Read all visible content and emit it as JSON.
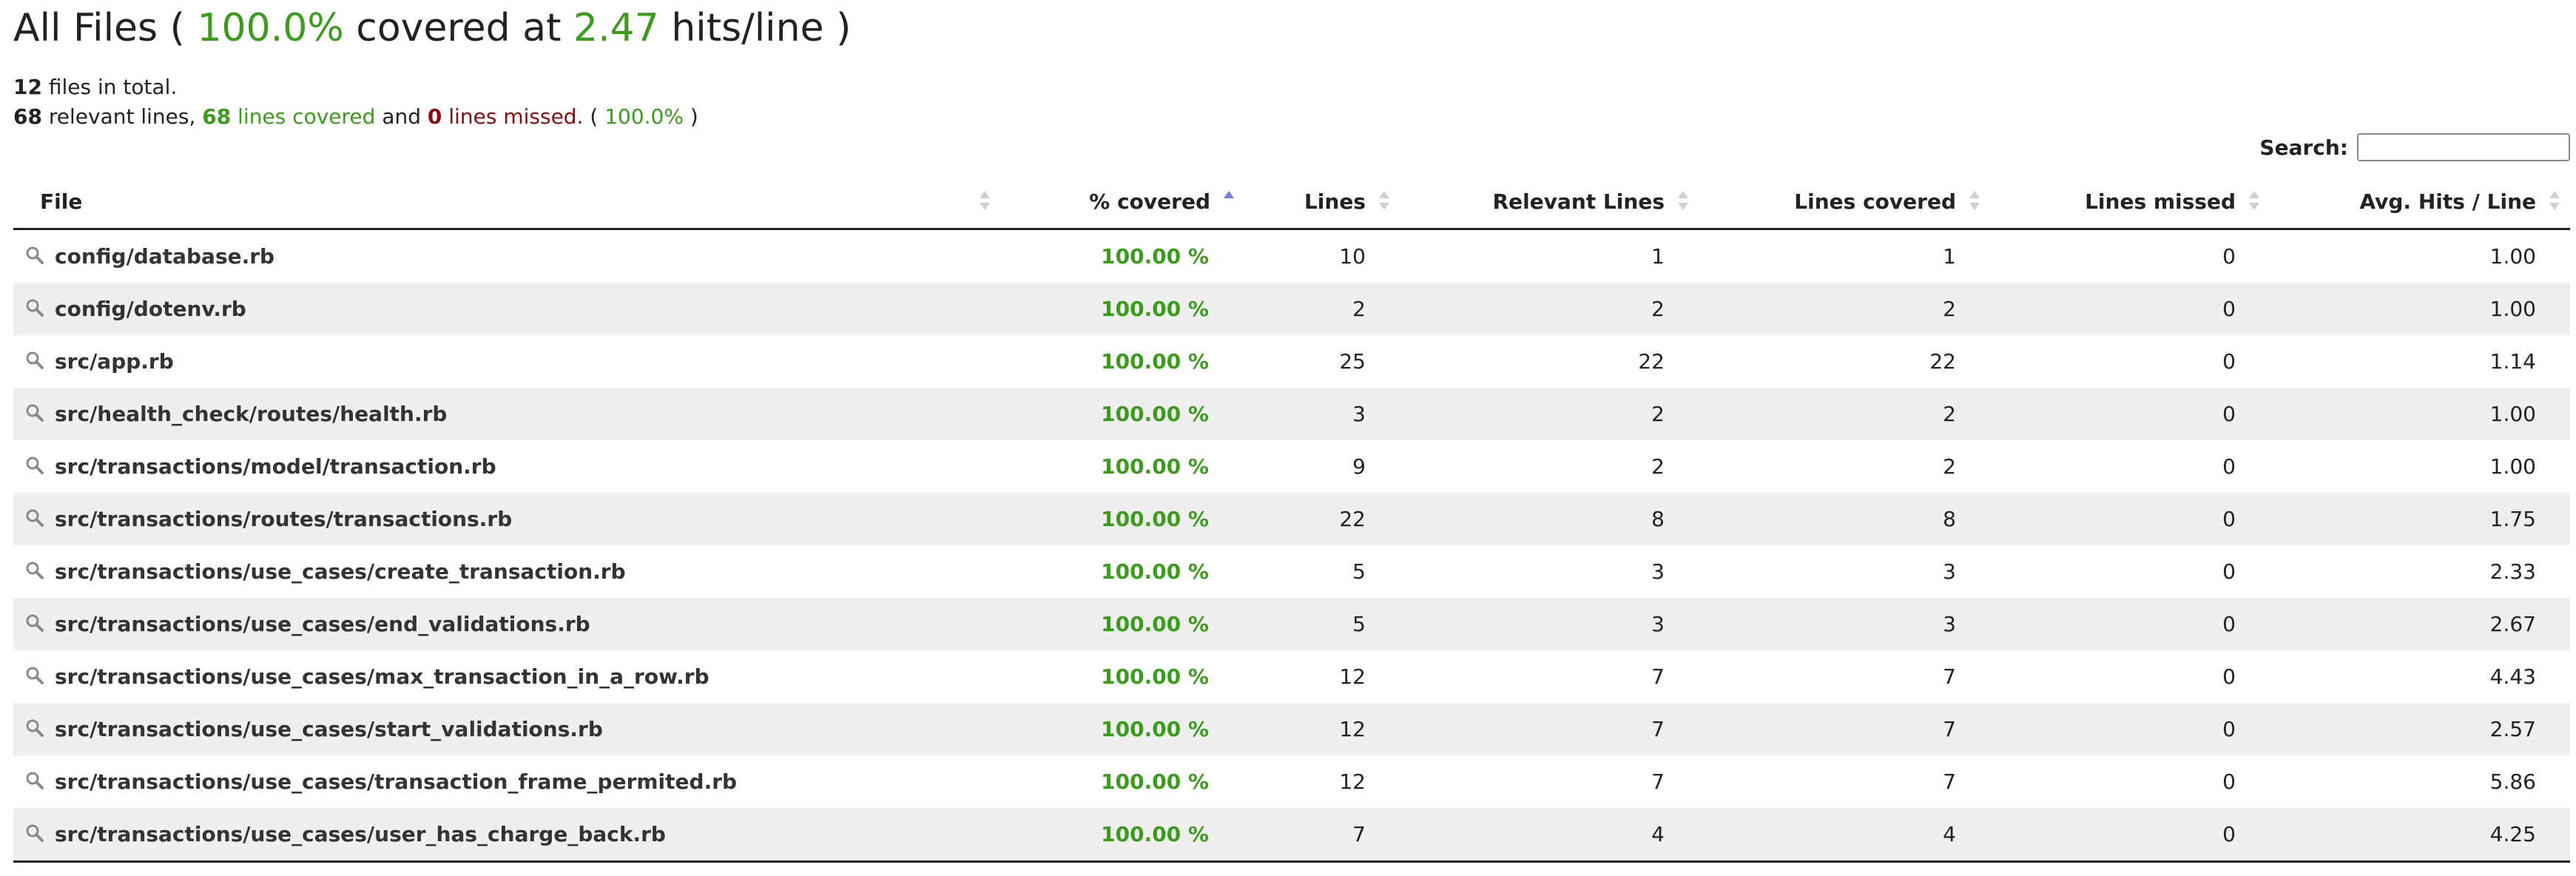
{
  "header": {
    "title_prefix": "All Files (",
    "covered_percent": "100.0%",
    "title_middle": "covered at",
    "hits_per_line": "2.47",
    "title_suffix": "hits/line )"
  },
  "summary": {
    "files_count": "12",
    "files_text": "files in total.",
    "relevant_lines": "68",
    "relevant_text": "relevant lines,",
    "lines_covered": "68",
    "covered_text": "lines covered",
    "and_text": "and",
    "lines_missed": "0",
    "missed_text": "lines missed.",
    "paren_open": "(",
    "percent": "100.0%",
    "paren_close": ")"
  },
  "search": {
    "label": "Search:",
    "value": "",
    "placeholder": ""
  },
  "table": {
    "headers": {
      "file": "File",
      "covered": "% covered",
      "lines": "Lines",
      "relevant": "Relevant Lines",
      "covered_lines": "Lines covered",
      "missed": "Lines missed",
      "avg": "Avg. Hits / Line"
    },
    "sorted_column": "covered",
    "sort_direction": "ascending",
    "rows": [
      {
        "file": "config/database.rb",
        "covered": "100.00 %",
        "lines": "10",
        "relevant": "1",
        "covered_lines": "1",
        "missed": "0",
        "avg": "1.00"
      },
      {
        "file": "config/dotenv.rb",
        "covered": "100.00 %",
        "lines": "2",
        "relevant": "2",
        "covered_lines": "2",
        "missed": "0",
        "avg": "1.00"
      },
      {
        "file": "src/app.rb",
        "covered": "100.00 %",
        "lines": "25",
        "relevant": "22",
        "covered_lines": "22",
        "missed": "0",
        "avg": "1.14"
      },
      {
        "file": "src/health_check/routes/health.rb",
        "covered": "100.00 %",
        "lines": "3",
        "relevant": "2",
        "covered_lines": "2",
        "missed": "0",
        "avg": "1.00"
      },
      {
        "file": "src/transactions/model/transaction.rb",
        "covered": "100.00 %",
        "lines": "9",
        "relevant": "2",
        "covered_lines": "2",
        "missed": "0",
        "avg": "1.00"
      },
      {
        "file": "src/transactions/routes/transactions.rb",
        "covered": "100.00 %",
        "lines": "22",
        "relevant": "8",
        "covered_lines": "8",
        "missed": "0",
        "avg": "1.75"
      },
      {
        "file": "src/transactions/use_cases/create_transaction.rb",
        "covered": "100.00 %",
        "lines": "5",
        "relevant": "3",
        "covered_lines": "3",
        "missed": "0",
        "avg": "2.33"
      },
      {
        "file": "src/transactions/use_cases/end_validations.rb",
        "covered": "100.00 %",
        "lines": "5",
        "relevant": "3",
        "covered_lines": "3",
        "missed": "0",
        "avg": "2.67"
      },
      {
        "file": "src/transactions/use_cases/max_transaction_in_a_row.rb",
        "covered": "100.00 %",
        "lines": "12",
        "relevant": "7",
        "covered_lines": "7",
        "missed": "0",
        "avg": "4.43"
      },
      {
        "file": "src/transactions/use_cases/start_validations.rb",
        "covered": "100.00 %",
        "lines": "12",
        "relevant": "7",
        "covered_lines": "7",
        "missed": "0",
        "avg": "2.57"
      },
      {
        "file": "src/transactions/use_cases/transaction_frame_permited.rb",
        "covered": "100.00 %",
        "lines": "12",
        "relevant": "7",
        "covered_lines": "7",
        "missed": "0",
        "avg": "5.86"
      },
      {
        "file": "src/transactions/use_cases/user_has_charge_back.rb",
        "covered": "100.00 %",
        "lines": "7",
        "relevant": "4",
        "covered_lines": "4",
        "missed": "0",
        "avg": "4.25"
      }
    ]
  },
  "colors": {
    "green": "#3a9c1b",
    "red": "#8a0b0b",
    "row_stripe": "#efefef",
    "sort_active": "#6f7ee0"
  },
  "icons": {
    "row_icon": "magnifier-icon",
    "sort_icon": "sort-arrows-icon"
  }
}
